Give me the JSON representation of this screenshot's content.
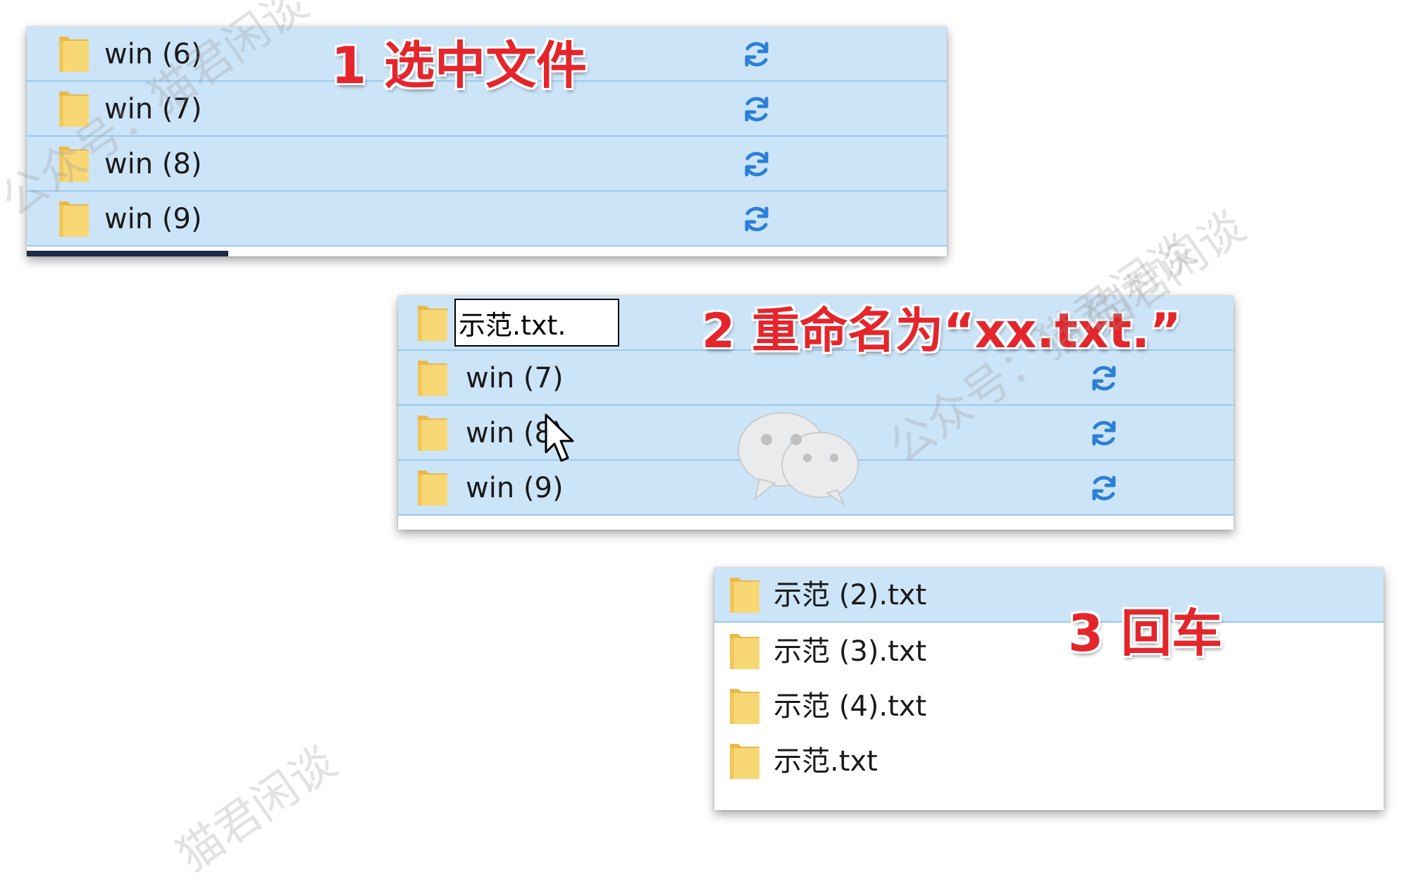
{
  "panel1": {
    "callout": "1 选中文件",
    "rows": [
      {
        "name": "win (6)"
      },
      {
        "name": "win (7)"
      },
      {
        "name": "win (8)"
      },
      {
        "name": "win (9)"
      }
    ]
  },
  "panel2": {
    "callout": "2 重命名为“xx.txt.”",
    "rename_value": "示范.txt.",
    "rows": [
      {
        "name": "win (7)"
      },
      {
        "name": "win (8)"
      },
      {
        "name": "win (9)"
      }
    ]
  },
  "panel3": {
    "callout": "3 回车",
    "rows": [
      {
        "name": "示范 (2).txt"
      },
      {
        "name": "示范 (3).txt"
      },
      {
        "name": "示范 (4).txt"
      },
      {
        "name": "示范.txt"
      }
    ]
  },
  "watermarks": [
    "公众号：猫君闲谈",
    "猫君闲谈",
    "公众号：猫君闲谈",
    "猫君闲谈"
  ],
  "colors": {
    "selection": "#cce4f7",
    "selection_border": "#99c9ef",
    "folder": "#f8d775",
    "sync_icon": "#2b7fd8",
    "callout": "#e4262c"
  },
  "icons": {
    "folder": "folder-icon",
    "sync": "sync-icon",
    "cursor": "mouse-cursor-icon",
    "wechat": "wechat-logo"
  }
}
